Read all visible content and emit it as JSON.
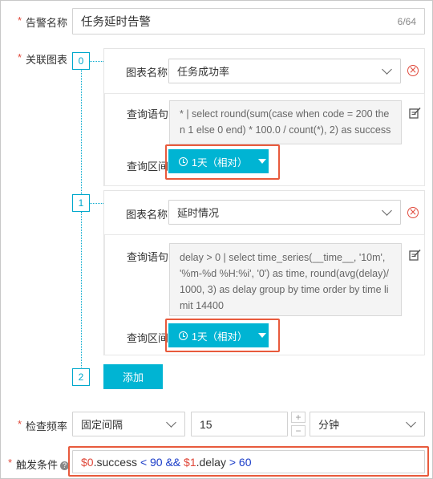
{
  "alert_name": {
    "label": "告警名称",
    "value": "任务延时告警",
    "counter": "6/64"
  },
  "linked_charts": {
    "label": "关联图表",
    "chart_name_label": "图表名称",
    "query_label": "查询语句",
    "range_label": "查询区间",
    "charts": [
      {
        "index": "0",
        "name": "任务成功率",
        "query": "* | select round(sum(case when code = 200 then 1 else 0 end) * 100.0 / count(*), 2) as success",
        "range": "1天（相对）"
      },
      {
        "index": "1",
        "name": "延时情况",
        "query": "delay > 0 | select time_series(__time__, '10m', '%m-%d %H:%i', '0') as time, round(avg(delay)/1000, 3) as delay group by time order by time limit 14400",
        "range": "1天（相对）"
      }
    ],
    "next_index": "2",
    "add_label": "添加"
  },
  "check_frequency": {
    "label": "检查频率",
    "mode": "固定间隔",
    "value": "15",
    "unit": "分钟",
    "inc": "+",
    "dec": "−"
  },
  "trigger": {
    "label": "触发条件",
    "help": "?",
    "tokens": [
      {
        "text": "$0",
        "color": "#e0483a"
      },
      {
        "text": ".success ",
        "color": "#333333"
      },
      {
        "text": "< 90 && ",
        "color": "#1a3cc8"
      },
      {
        "text": "$1",
        "color": "#e0483a"
      },
      {
        "text": ".delay ",
        "color": "#333333"
      },
      {
        "text": "> 60",
        "color": "#1a3cc8"
      }
    ]
  },
  "colors": {
    "accent": "#00b4d3",
    "highlight": "#e85a3c",
    "required": "#e0483a"
  },
  "required_mark": "*",
  "delete_glyph": "×"
}
